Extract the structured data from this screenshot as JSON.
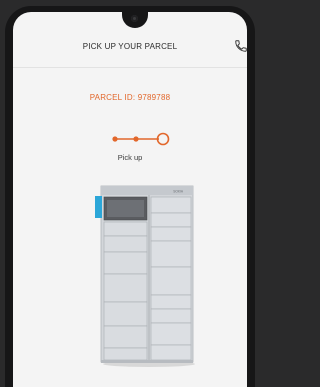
{
  "header": {
    "title": "PICK UP YOUR PARCEL",
    "call_icon": "phone-icon"
  },
  "parcel": {
    "id_label": "PARCEL ID: 9789788"
  },
  "progress": {
    "steps_total": 3,
    "current_step": 3,
    "active_color": "#e2672b",
    "step_label": "Pick up"
  },
  "locker": {
    "brand": "SOKIA",
    "highlight_color": "#2ba6d8",
    "body_color": "#cfd2d6",
    "screen_color": "#5a5c60"
  },
  "colors": {
    "accent": "#e2672b",
    "background": "#f4f4f4"
  }
}
